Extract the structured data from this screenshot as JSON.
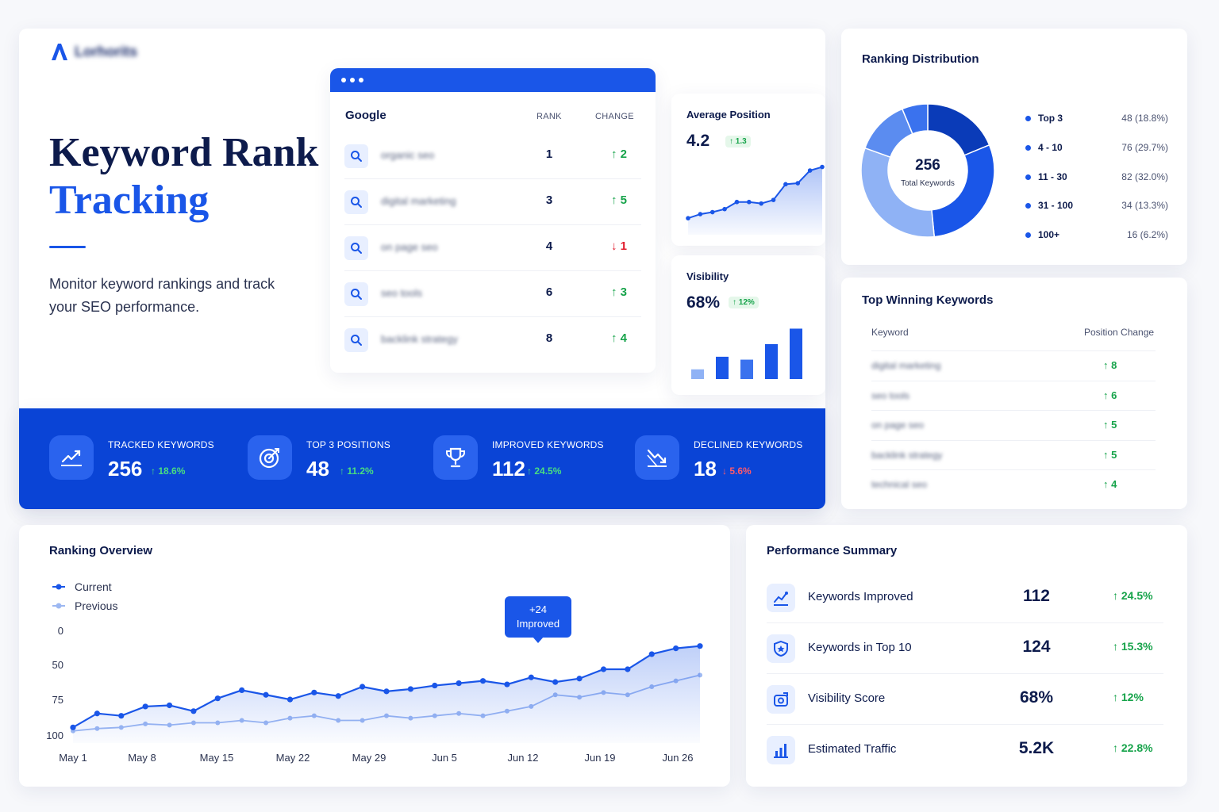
{
  "hero": {
    "title_line1": "Keyword Rank",
    "title_line2": "Tracking",
    "subtitle": "Monitor keyword rankings and track your SEO performance.",
    "accent_color": "#1a56e8"
  },
  "google_card": {
    "title": "Google",
    "col_rank": "RANK",
    "col_change": "CHANGE",
    "rows": [
      {
        "keyword": "organic seo",
        "rank": "1",
        "change": "2",
        "direction": "up"
      },
      {
        "keyword": "digital marketing",
        "rank": "3",
        "change": "5",
        "direction": "up"
      },
      {
        "keyword": "on page seo",
        "rank": "4",
        "change": "1",
        "direction": "down"
      },
      {
        "keyword": "seo tools",
        "rank": "6",
        "change": "3",
        "direction": "up"
      },
      {
        "keyword": "backlink strategy",
        "rank": "8",
        "change": "4",
        "direction": "up"
      }
    ]
  },
  "avg_position": {
    "title": "Average Position",
    "value": "4.2",
    "change": "1.3",
    "sparkline": [
      2,
      2.8,
      3.2,
      3.8,
      5.2,
      5.2,
      4.9,
      5.6,
      8.7,
      8.9,
      11.4,
      12.1
    ]
  },
  "visibility": {
    "title": "Visibility",
    "value": "68%",
    "change": "12%",
    "bars": [
      1.0,
      2.3,
      2.0,
      3.6,
      5.2
    ]
  },
  "stats": [
    {
      "label": "TRACKED KEYWORDS",
      "value": "256",
      "change": "18.6%",
      "direction": "up",
      "icon": "line-chart-icon"
    },
    {
      "label": "TOP 3 POSITIONS",
      "value": "48",
      "change": "11.2%",
      "direction": "up",
      "icon": "target-icon"
    },
    {
      "label": "IMPROVED KEYWORDS",
      "value": "112",
      "change": "24.5%",
      "direction": "up",
      "icon": "trophy-icon"
    },
    {
      "label": "DECLINED KEYWORDS",
      "value": "18",
      "change": "5.6%",
      "direction": "down",
      "icon": "declining-chart-icon"
    }
  ],
  "distribution": {
    "title": "Ranking Distribution",
    "center_value": "256",
    "center_label": "Total Keywords",
    "items": [
      {
        "label": "Top 3",
        "value": "48 (18.8%)",
        "count": 48,
        "color": "#0a3bb8"
      },
      {
        "label": "4 - 10",
        "value": "76 (29.7%)",
        "count": 76,
        "color": "#1a56e8"
      },
      {
        "label": "11 - 30",
        "value": "82 (32.0%)",
        "count": 82,
        "color": "#8fb2f5"
      },
      {
        "label": "31 - 100",
        "value": "34 (13.3%)",
        "count": 34,
        "color": "#5b8cf0"
      },
      {
        "label": "100+",
        "value": "16 (6.2%)",
        "count": 16,
        "color": "#3a72ee"
      }
    ]
  },
  "winning": {
    "title": "Top Winning Keywords",
    "col_keyword": "Keyword",
    "col_change": "Position Change",
    "rows": [
      {
        "keyword": "digital marketing",
        "change": "8"
      },
      {
        "keyword": "seo tools",
        "change": "6"
      },
      {
        "keyword": "on page seo",
        "change": "5"
      },
      {
        "keyword": "backlink strategy",
        "change": "5"
      },
      {
        "keyword": "technical seo",
        "change": "4"
      }
    ]
  },
  "overview": {
    "title": "Ranking Overview",
    "legend_current": "Current",
    "legend_previous": "Previous",
    "callout_line1": "+24",
    "callout_line2": "Improved"
  },
  "chart_data": {
    "type": "line",
    "title": "Ranking Overview",
    "x_ticks": [
      "May 1",
      "May 8",
      "May 15",
      "May 22",
      "May 29",
      "Jun 5",
      "Jun 12",
      "Jun 19",
      "Jun 26"
    ],
    "y_ticks": [
      "0",
      "50",
      "75",
      "100"
    ],
    "y_axis": "inverted",
    "series": [
      {
        "name": "Current",
        "color": "#1a56e8",
        "values": [
          90,
          78,
          80,
          72,
          71,
          76,
          65,
          58,
          62,
          66,
          60,
          63,
          55,
          59,
          57,
          54,
          52,
          50,
          53,
          47,
          51,
          48,
          40,
          40,
          27,
          22,
          20
        ]
      },
      {
        "name": "Previous",
        "color": "#9db8f2",
        "values": [
          93,
          91,
          90,
          87,
          88,
          86,
          86,
          84,
          86,
          82,
          80,
          84,
          84,
          80,
          82,
          80,
          78,
          80,
          76,
          72,
          62,
          64,
          60,
          62,
          55,
          50,
          45
        ]
      }
    ]
  },
  "performance": {
    "title": "Performance Summary",
    "rows": [
      {
        "label": "Keywords Improved",
        "value": "112",
        "change": "24.5%",
        "icon": "improve-chart-icon"
      },
      {
        "label": "Keywords in Top 10",
        "value": "124",
        "change": "15.3%",
        "icon": "shield-icon"
      },
      {
        "label": "Visibility Score",
        "value": "68%",
        "change": "12%",
        "icon": "eye-gauge-icon"
      },
      {
        "label": "Estimated Traffic",
        "value": "5.2K",
        "change": "22.8%",
        "icon": "bar-chart-icon"
      }
    ]
  }
}
